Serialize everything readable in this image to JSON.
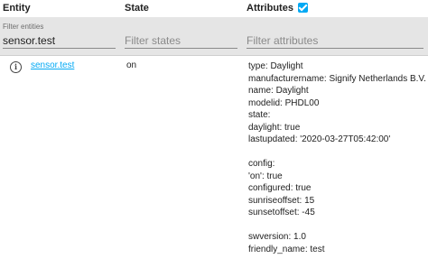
{
  "header": {
    "entity_label": "Entity",
    "state_label": "State",
    "attributes_label": "Attributes"
  },
  "filters": {
    "entity_float_label": "Filter entities",
    "entity_value": "sensor.test",
    "state_placeholder": "Filter states",
    "attributes_placeholder": "Filter attributes"
  },
  "row": {
    "entity_id": "sensor.test",
    "state": "on",
    "attributes": [
      "type: Daylight",
      "manufacturername: Signify Netherlands B.V.",
      "name: Daylight",
      "modelid: PHDL00",
      "state:",
      "daylight: true",
      "lastupdated: '2020-03-27T05:42:00'",
      "",
      "config:",
      "'on': true",
      "configured: true",
      "sunriseoffset: 15",
      "sunsetoffset: -45",
      "",
      "swversion: 1.0",
      "friendly_name: test"
    ]
  },
  "colors": {
    "accent": "#03a9f4",
    "filter_background": "#e5e5e5"
  },
  "icons": {
    "info": "info-circle-icon",
    "checkbox": "checkbox-checked-icon"
  }
}
